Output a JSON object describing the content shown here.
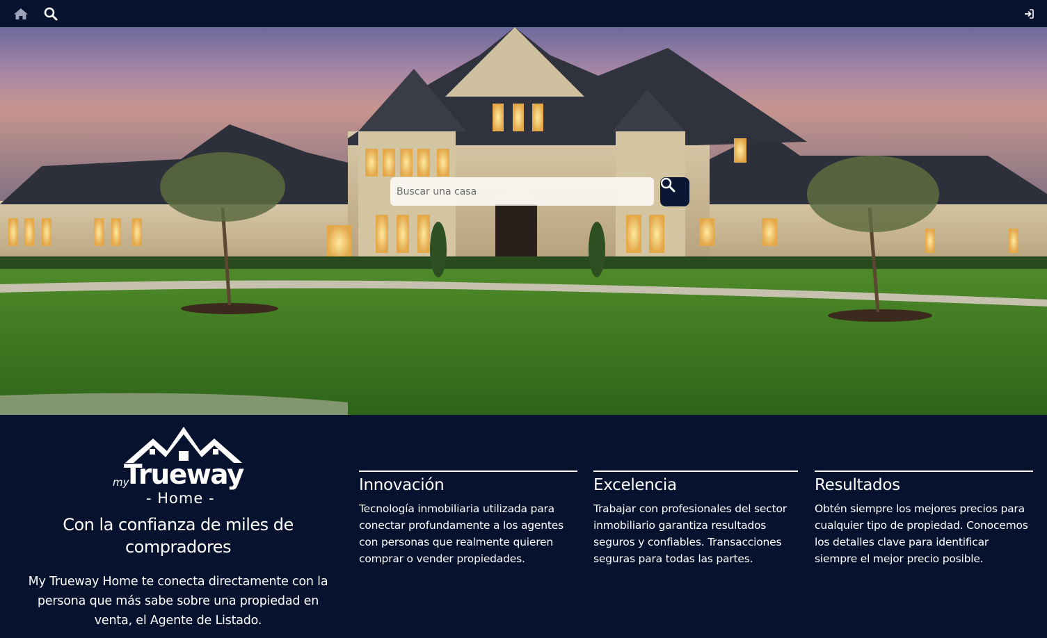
{
  "topbar": {
    "home_icon": "home-icon",
    "search_icon": "search-icon",
    "login_icon": "sign-in-icon"
  },
  "hero": {
    "search": {
      "placeholder": "Buscar una casa",
      "value": "",
      "button_icon": "search-icon"
    }
  },
  "brand": {
    "logo": {
      "my": "my",
      "name": "Trueway",
      "sub": "- Home -"
    },
    "tagline": "Con la confianza de miles de compradores",
    "intro": "My Trueway Home te conecta directamente con la persona que más sabe sobre una propiedad en venta, el Agente de Listado."
  },
  "features": [
    {
      "title": "Innovación",
      "text": "Tecnología inmobiliaria utilizada para conectar profundamente a los agentes con personas que realmente quieren comprar o vender propiedades."
    },
    {
      "title": "Excelencia",
      "text": "Trabajar con profesionales del sector inmobiliario garantiza resultados seguros y confiables. Transacciones seguras para todas las partes."
    },
    {
      "title": "Resultados",
      "text": "Obtén siempre los mejores precios para cualquier tipo de propiedad. Conocemos los detalles clave para identificar siempre el mejor precio posible."
    }
  ],
  "colors": {
    "navy": "#07122f",
    "white": "#ffffff",
    "search_button": "#0b1634"
  }
}
